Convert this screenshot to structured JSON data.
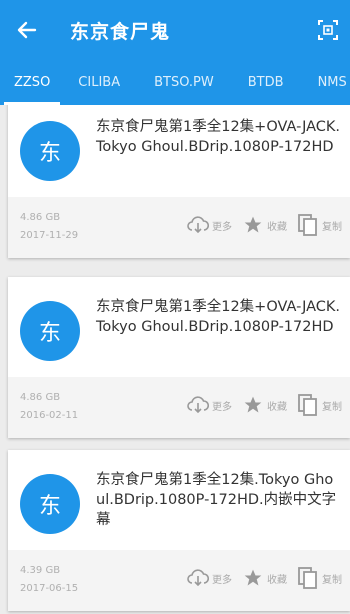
{
  "appbar": {
    "title": "东京食尸鬼",
    "back_icon": "arrow-left-icon",
    "qr_icon": "qr-scan-icon",
    "color": "#1f95e8"
  },
  "tabs": [
    {
      "label": "ZZSO",
      "active": true
    },
    {
      "label": "CILIBA",
      "active": false
    },
    {
      "label": "BTSO.PW",
      "active": false
    },
    {
      "label": "BTDB",
      "active": false
    },
    {
      "label": "NMS",
      "active": false
    }
  ],
  "results": [
    {
      "avatar": "东",
      "name": "东京食尸鬼第1季全12集+OVA-JACK.Tokyo Ghoul.BDrip.1080P-172HD",
      "size": "4.86 GB",
      "date": "2017-11-29",
      "more": "更多",
      "fav": "收藏",
      "copy": "复制"
    },
    {
      "avatar": "东",
      "name": "东京食尸鬼第1季全12集+OVA-JACK.Tokyo Ghoul.BDrip.1080P-172HD",
      "size": "4.86 GB",
      "date": "2016-02-11",
      "more": "更多",
      "fav": "收藏",
      "copy": "复制"
    },
    {
      "avatar": "东",
      "name": "东京食尸鬼第1季全12集.Tokyo Ghoul.BDrip.1080P-172HD.内嵌中文字幕",
      "size": "4.39 GB",
      "date": "2017-06-15",
      "more": "更多",
      "fav": "收藏",
      "copy": "复制"
    }
  ]
}
